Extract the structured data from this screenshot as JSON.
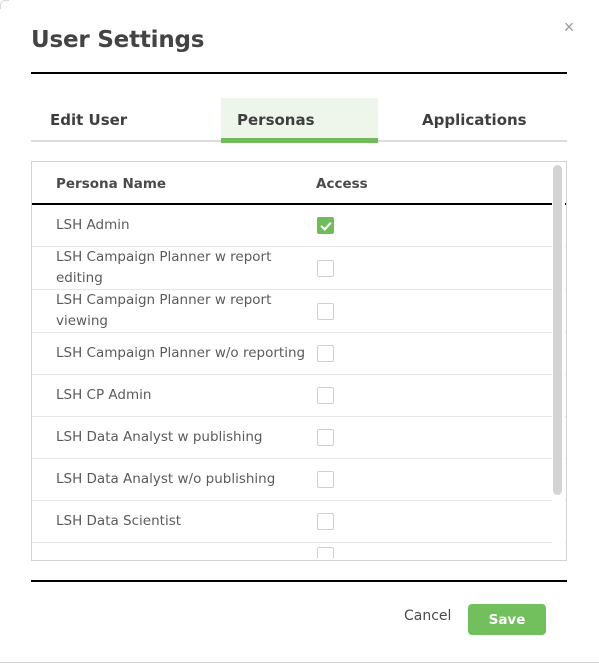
{
  "modal": {
    "title": "User Settings",
    "close_icon": "close-icon",
    "close_glyph": "×"
  },
  "tabs": [
    {
      "label": "Edit User",
      "active": false
    },
    {
      "label": "Personas",
      "active": true
    },
    {
      "label": "Applications",
      "active": false
    }
  ],
  "table": {
    "columns": [
      "Persona Name",
      "Access"
    ],
    "rows": [
      {
        "name": "LSH Admin",
        "access": true
      },
      {
        "name": "LSH Campaign Planner w report editing",
        "access": false
      },
      {
        "name": "LSH Campaign Planner w report viewing",
        "access": false
      },
      {
        "name": "LSH Campaign Planner w/o reporting",
        "access": false
      },
      {
        "name": "LSH CP Admin",
        "access": false
      },
      {
        "name": "LSH Data Analyst w publishing",
        "access": false
      },
      {
        "name": "LSH Data Analyst w/o publishing",
        "access": false
      },
      {
        "name": "LSH Data Scientist",
        "access": false
      }
    ]
  },
  "footer": {
    "cancel_label": "Cancel",
    "save_label": "Save"
  },
  "colors": {
    "accent_green": "#6fba5b",
    "save_button": "#71c05d",
    "active_tab_bg": "#eef6ec",
    "checkbox_checked": "#6ebd5a",
    "text": "#4a4a4a"
  }
}
